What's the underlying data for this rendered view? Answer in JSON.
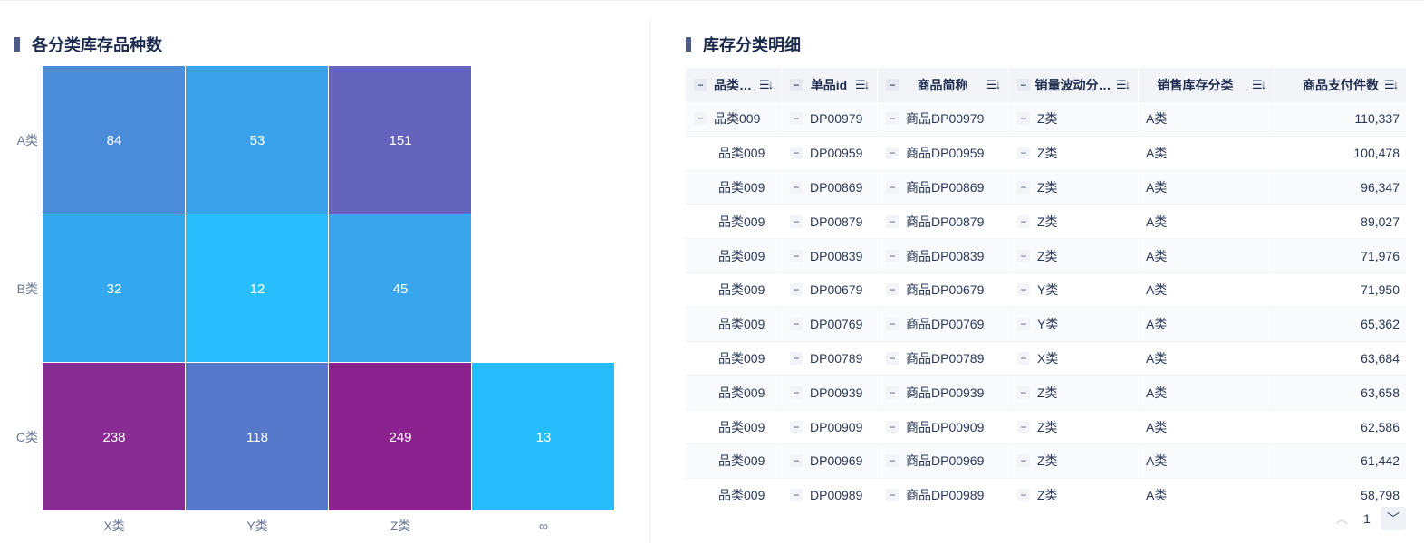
{
  "left_panel": {
    "title": "各分类库存品种数"
  },
  "right_panel": {
    "title": "库存分类明细"
  },
  "chart_data": {
    "type": "heatmap",
    "x_categories": [
      "X类",
      "Y类",
      "Z类",
      "∞"
    ],
    "y_categories": [
      "A类",
      "B类",
      "C类"
    ],
    "cells": [
      {
        "row": "A类",
        "col": "X类",
        "value": 84,
        "color": "#4a8cd9"
      },
      {
        "row": "A类",
        "col": "Y类",
        "value": 53,
        "color": "#3aa2ea"
      },
      {
        "row": "A类",
        "col": "Z类",
        "value": 151,
        "color": "#6464bd"
      },
      {
        "row": "B类",
        "col": "X类",
        "value": 32,
        "color": "#34a8ee"
      },
      {
        "row": "B类",
        "col": "Y类",
        "value": 12,
        "color": "#28bdfc"
      },
      {
        "row": "B类",
        "col": "Z类",
        "value": 45,
        "color": "#38a5ec"
      },
      {
        "row": "C类",
        "col": "X类",
        "value": 238,
        "color": "#882b93"
      },
      {
        "row": "C类",
        "col": "Y类",
        "value": 118,
        "color": "#5678cb"
      },
      {
        "row": "C类",
        "col": "Z类",
        "value": 249,
        "color": "#8b228f"
      },
      {
        "row": "C类",
        "col": "∞",
        "value": 13,
        "color": "#27bdfd"
      }
    ]
  },
  "table": {
    "columns": [
      {
        "label": "品类…",
        "collapse": "−",
        "sort": "☰↓"
      },
      {
        "label": "单品id",
        "collapse": "−",
        "sort": "☰↓"
      },
      {
        "label": "商品简称",
        "collapse": "−",
        "sort": "☰↓"
      },
      {
        "label": "销量波动分…",
        "collapse": "−",
        "sort": "☰↓"
      },
      {
        "label": "销售库存分类",
        "collapse": "",
        "sort": "☰↓"
      },
      {
        "label": "商品支付件数",
        "collapse": "",
        "sort": "☰↓"
      }
    ],
    "rows": [
      {
        "category": "品类009",
        "id": "DP00979",
        "name": "商品DP00979",
        "volatility": "Z类",
        "stock_class": "A类",
        "qty": "110,337"
      },
      {
        "category": "品类009",
        "id": "DP00959",
        "name": "商品DP00959",
        "volatility": "Z类",
        "stock_class": "A类",
        "qty": "100,478"
      },
      {
        "category": "品类009",
        "id": "DP00869",
        "name": "商品DP00869",
        "volatility": "Z类",
        "stock_class": "A类",
        "qty": "96,347"
      },
      {
        "category": "品类009",
        "id": "DP00879",
        "name": "商品DP00879",
        "volatility": "Z类",
        "stock_class": "A类",
        "qty": "89,027"
      },
      {
        "category": "品类009",
        "id": "DP00839",
        "name": "商品DP00839",
        "volatility": "Z类",
        "stock_class": "A类",
        "qty": "71,976"
      },
      {
        "category": "品类009",
        "id": "DP00679",
        "name": "商品DP00679",
        "volatility": "Y类",
        "stock_class": "A类",
        "qty": "71,950"
      },
      {
        "category": "品类009",
        "id": "DP00769",
        "name": "商品DP00769",
        "volatility": "Y类",
        "stock_class": "A类",
        "qty": "65,362"
      },
      {
        "category": "品类009",
        "id": "DP00789",
        "name": "商品DP00789",
        "volatility": "X类",
        "stock_class": "A类",
        "qty": "63,684"
      },
      {
        "category": "品类009",
        "id": "DP00939",
        "name": "商品DP00939",
        "volatility": "Z类",
        "stock_class": "A类",
        "qty": "63,658"
      },
      {
        "category": "品类009",
        "id": "DP00909",
        "name": "商品DP00909",
        "volatility": "Z类",
        "stock_class": "A类",
        "qty": "62,586"
      },
      {
        "category": "品类009",
        "id": "DP00969",
        "name": "商品DP00969",
        "volatility": "Z类",
        "stock_class": "A类",
        "qty": "61,442"
      },
      {
        "category": "品类009",
        "id": "DP00989",
        "name": "商品DP00989",
        "volatility": "Z类",
        "stock_class": "A类",
        "qty": "58,798"
      }
    ]
  },
  "pagination": {
    "page": "1",
    "prev_icon": "︿",
    "next_icon": "﹀"
  }
}
